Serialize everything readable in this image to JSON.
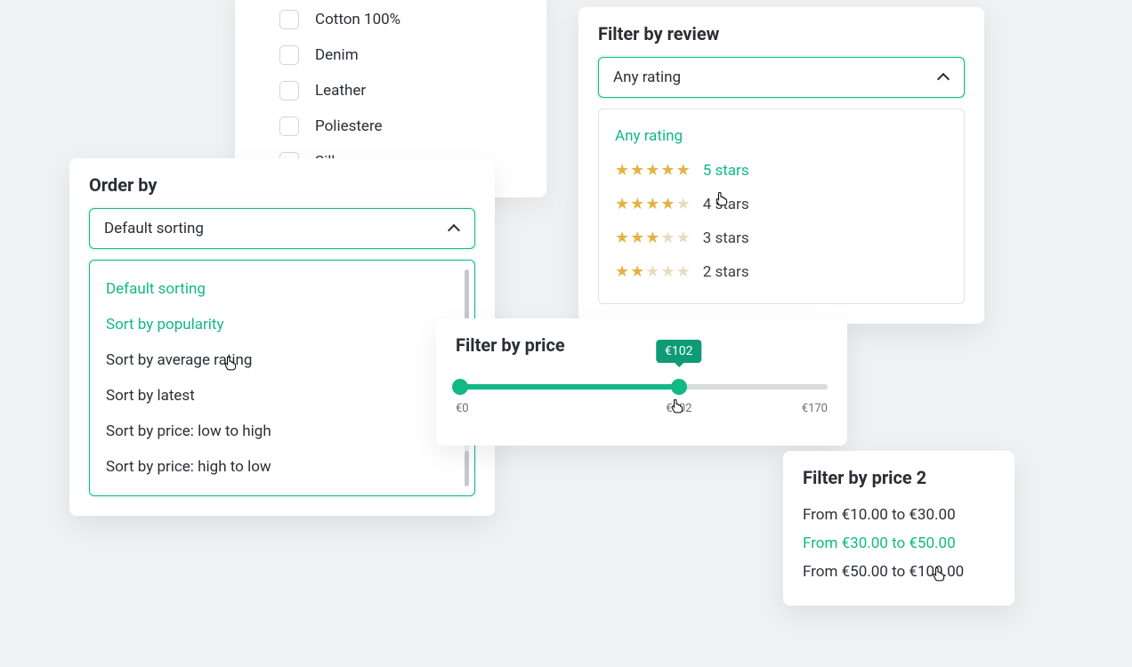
{
  "colors": {
    "accent": "#12b886",
    "text": "#2a2f36",
    "muted": "#6a6f75",
    "star": "#e3b341"
  },
  "materials": {
    "items": [
      {
        "label": "Cotton 100%",
        "checked": false
      },
      {
        "label": "Denim",
        "checked": false
      },
      {
        "label": "Leather",
        "checked": false
      },
      {
        "label": "Poliestere",
        "checked": false
      },
      {
        "label": "Silk",
        "checked": false
      }
    ]
  },
  "order_by": {
    "title": "Order by",
    "selected": "Default sorting",
    "options": [
      "Default sorting",
      "Sort by popularity",
      "Sort by average rating",
      "Sort by latest",
      "Sort by price: low to high",
      "Sort by price: high to low"
    ],
    "hover_index": 1
  },
  "filter_review": {
    "title": "Filter by review",
    "selected": "Any rating",
    "any_label": "Any rating",
    "items": [
      {
        "label": "5 stars",
        "filled": 5
      },
      {
        "label": "4 stars",
        "filled": 4
      },
      {
        "label": "3 stars",
        "filled": 3
      },
      {
        "label": "2 stars",
        "filled": 2
      }
    ],
    "hover_index": 0
  },
  "filter_price": {
    "title": "Filter by price",
    "min_label": "€0",
    "max_label": "€170",
    "current_label": "€102",
    "tooltip_label": "€102",
    "min": 0,
    "max": 170,
    "value": 102,
    "percent": 60
  },
  "filter_price2": {
    "title": "Filter by price 2",
    "options": [
      "From €10.00 to €30.00",
      "From €30.00 to €50.00",
      "From €50.00 to €100.00"
    ],
    "active_index": 1
  }
}
